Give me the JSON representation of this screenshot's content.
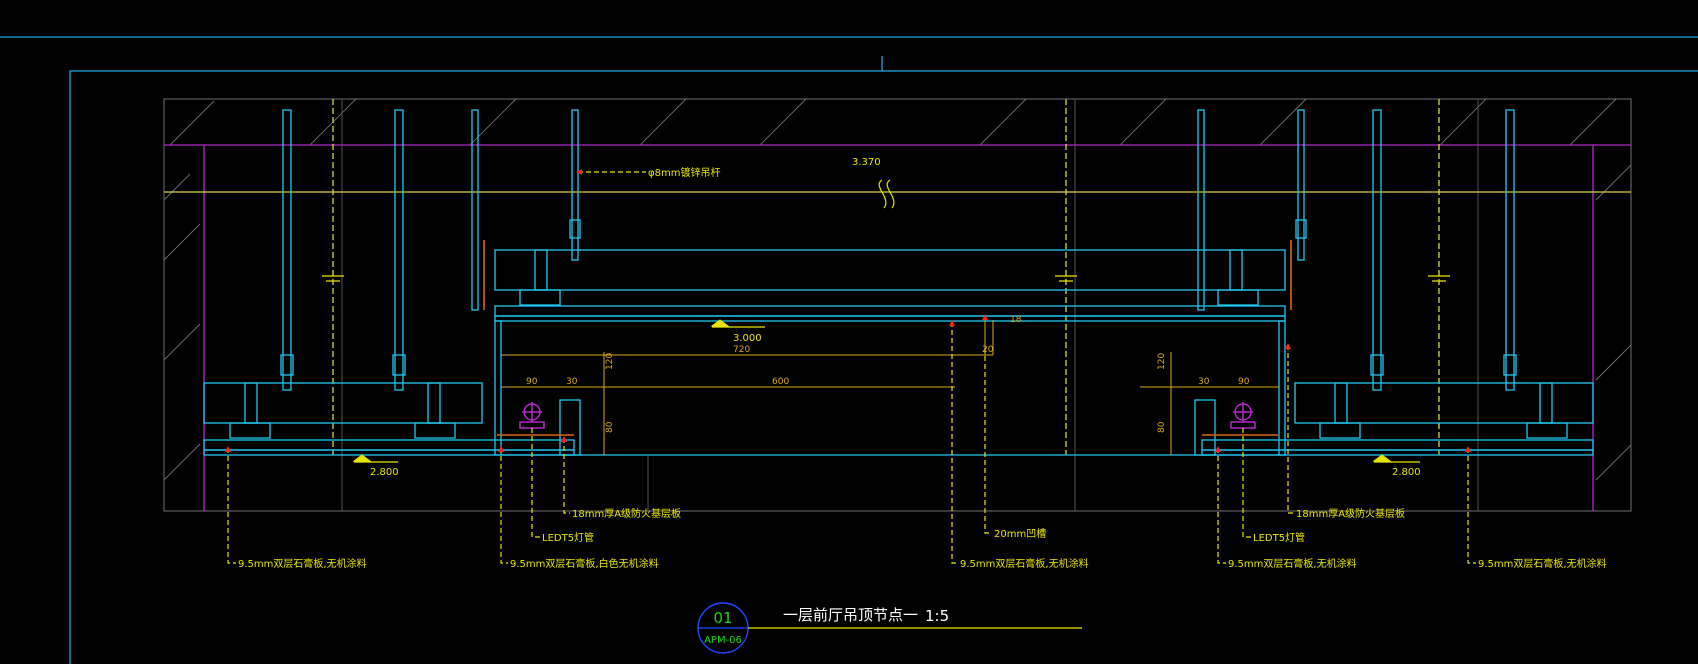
{
  "colors": {
    "background": "#000000",
    "frame": "#1aa3d9",
    "cyan": "#22c7ee",
    "yellow": "#e8e600",
    "magenta": "#b428c8",
    "orange": "#d9671a",
    "gray": "#6f6f6f",
    "red": "#ff2020",
    "green": "#19d219",
    "blue": "#2545ff"
  },
  "elevations": {
    "top": "3.370",
    "center": "3.000",
    "left": "2.800",
    "right": "2.800"
  },
  "dimensions": {
    "d720": "720",
    "d600": "600",
    "d90_left": "90",
    "d30_left": "30",
    "d30_right": "30",
    "d90_right": "90",
    "d120_left": "120",
    "d80_left": "80",
    "d120_right": "120",
    "d80_right": "80",
    "d20": "20",
    "d18": "18"
  },
  "annotations": {
    "hanger_rod": "φ8mm镀锌吊杆",
    "plywood_left": "18mm厚A级防火基层板",
    "plywood_right": "18mm厚A级防火基层板",
    "led_left": "LEDT5灯管",
    "led_right": "LEDT5灯管",
    "groove": "20mm凹槽",
    "gypsum_1": "9.5mm双层石膏板,无机涂料",
    "gypsum_2": "9.5mm双层石膏板,白色无机涂料",
    "gypsum_3": "9.5mm双层石膏板,无机涂料",
    "gypsum_4": "9.5mm双层石膏板,无机涂料",
    "gypsum_5": "9.5mm双层石膏板,无机涂料"
  },
  "title_block": {
    "number": "01",
    "sheet": "APM-06",
    "title": "一层前厅吊顶节点一",
    "scale": "1:5"
  }
}
